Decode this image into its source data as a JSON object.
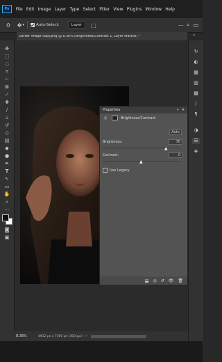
{
  "app": {
    "logo": "Ps"
  },
  "menu": [
    "File",
    "Edit",
    "Image",
    "Layer",
    "Type",
    "Select",
    "Filter",
    "View",
    "Plugins",
    "Window",
    "Help"
  ],
  "options": {
    "auto_select_label": "Auto-Select:",
    "auto_select_target": "Layer"
  },
  "document": {
    "tab_title": "Darker image copy.png @ 8.36% (Brightness/Contrast 1, Layer Mask/8) *"
  },
  "properties": {
    "title": "Properties",
    "adjustment_name": "Brightness/Contrast",
    "auto_label": "Auto",
    "brightness_label": "Brightness:",
    "brightness_value": "70",
    "brightness_level": 0.82,
    "contrast_label": "Contrast:",
    "contrast_value": "0",
    "contrast_level": 0.5,
    "use_legacy_label": "Use Legacy"
  },
  "status": {
    "zoom": "8.36%",
    "doc_info": "4912 px x 7360 px (300 ppi)"
  },
  "colors": {
    "accent": "#31a8ff"
  }
}
